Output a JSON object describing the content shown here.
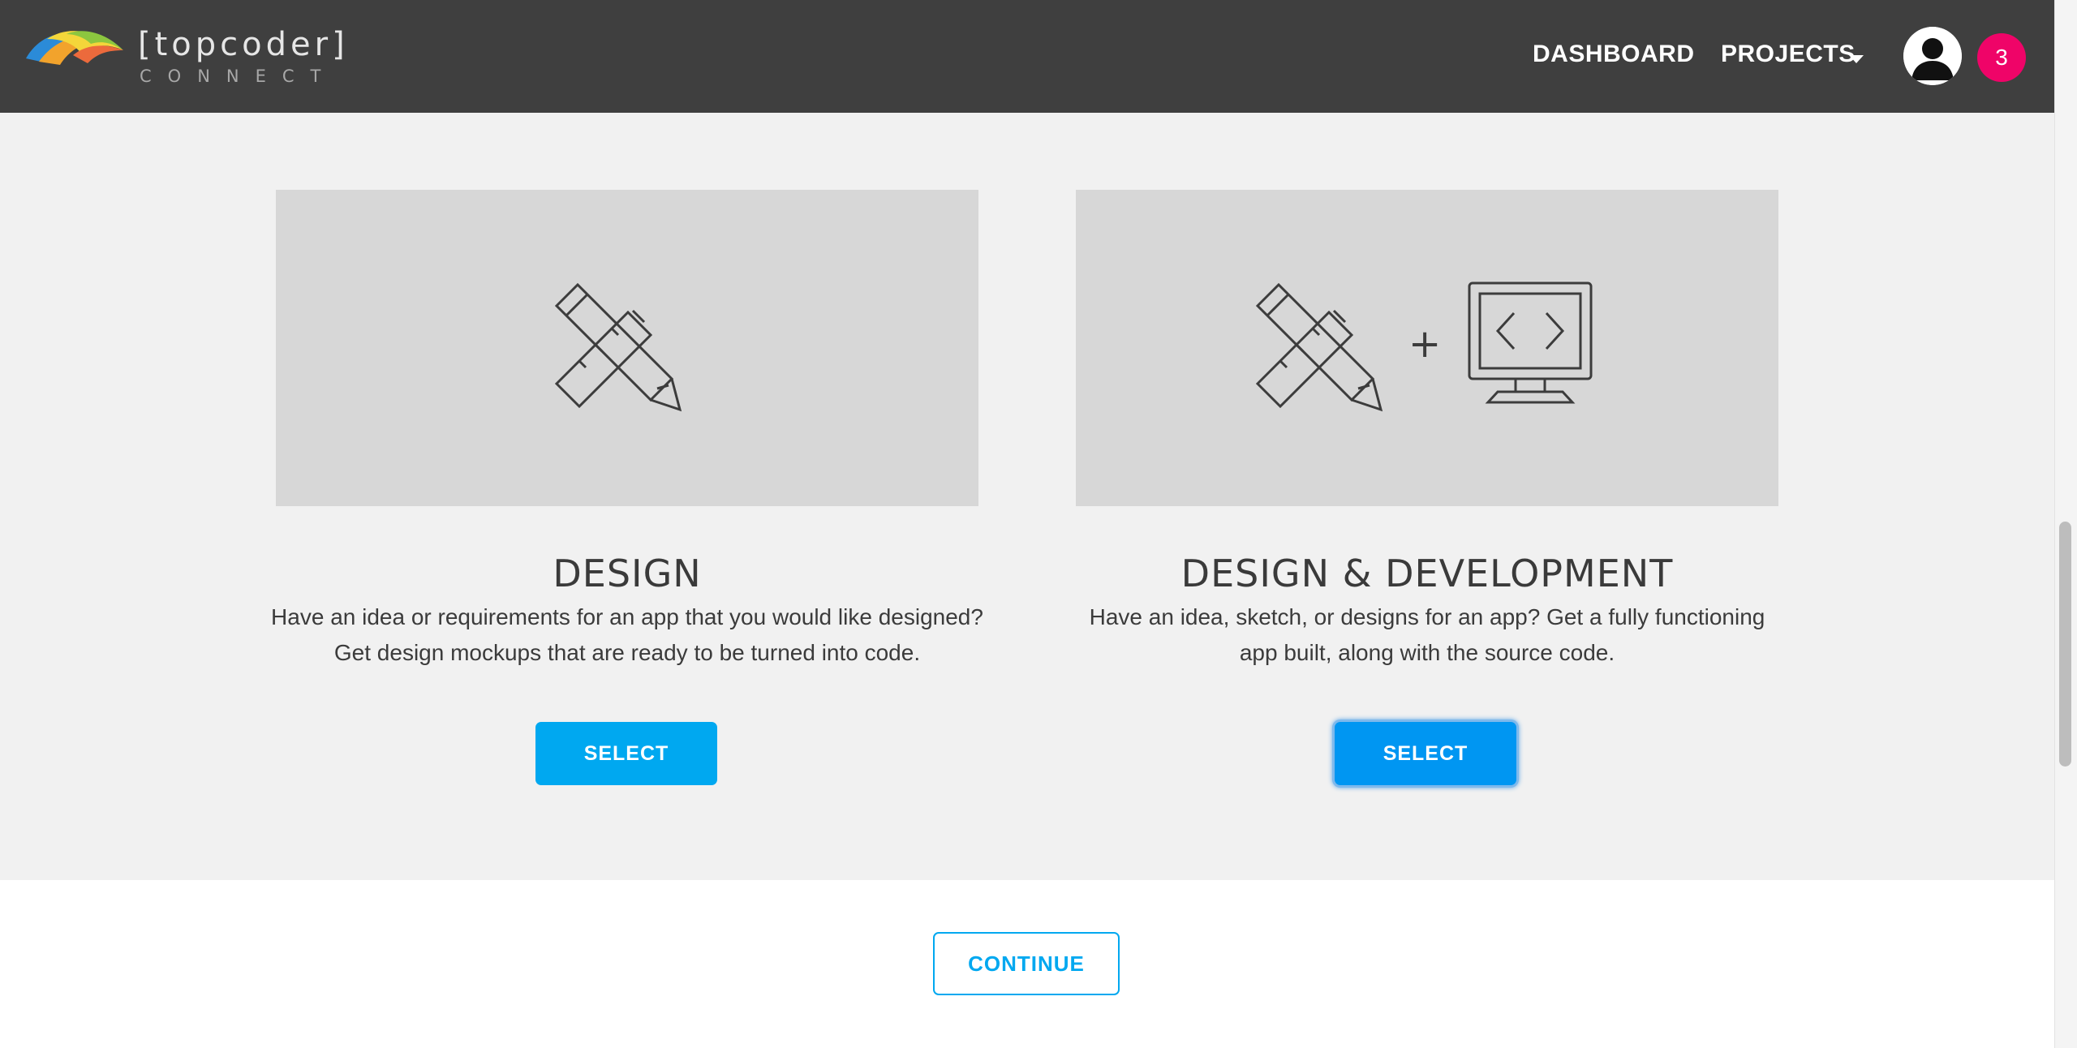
{
  "header": {
    "logo_text": "[topcoder]",
    "logo_subtext": "CONNECT",
    "nav": {
      "dashboard": "DASHBOARD",
      "projects": "PROJECTS"
    },
    "notification_count": "3",
    "icons": {
      "projects_dropdown": "chevron-down-icon",
      "avatar": "user-avatar-icon"
    }
  },
  "cards": [
    {
      "title": "DESIGN",
      "description": "Have an idea or requirements for an app that you would like designed? Get design mockups that are ready to be turned into code.",
      "button": "SELECT",
      "icons": [
        "ruler-pencil-icon"
      ]
    },
    {
      "title": "DESIGN & DEVELOPMENT",
      "description": "Have an idea, sketch, or designs for an app? Get a fully functioning app built, along with the source code.",
      "button": "SELECT",
      "plus_sign": "+",
      "icons": [
        "ruler-pencil-icon",
        "code-monitor-icon"
      ],
      "focused": true
    }
  ],
  "footer": {
    "continue": "CONTINUE"
  },
  "colors": {
    "header_bg": "#3f3f3f",
    "section_bg": "#f1f1f1",
    "card_image_bg": "#d7d7d7",
    "accent": "#00a8f0",
    "badge": "#ef0468"
  }
}
